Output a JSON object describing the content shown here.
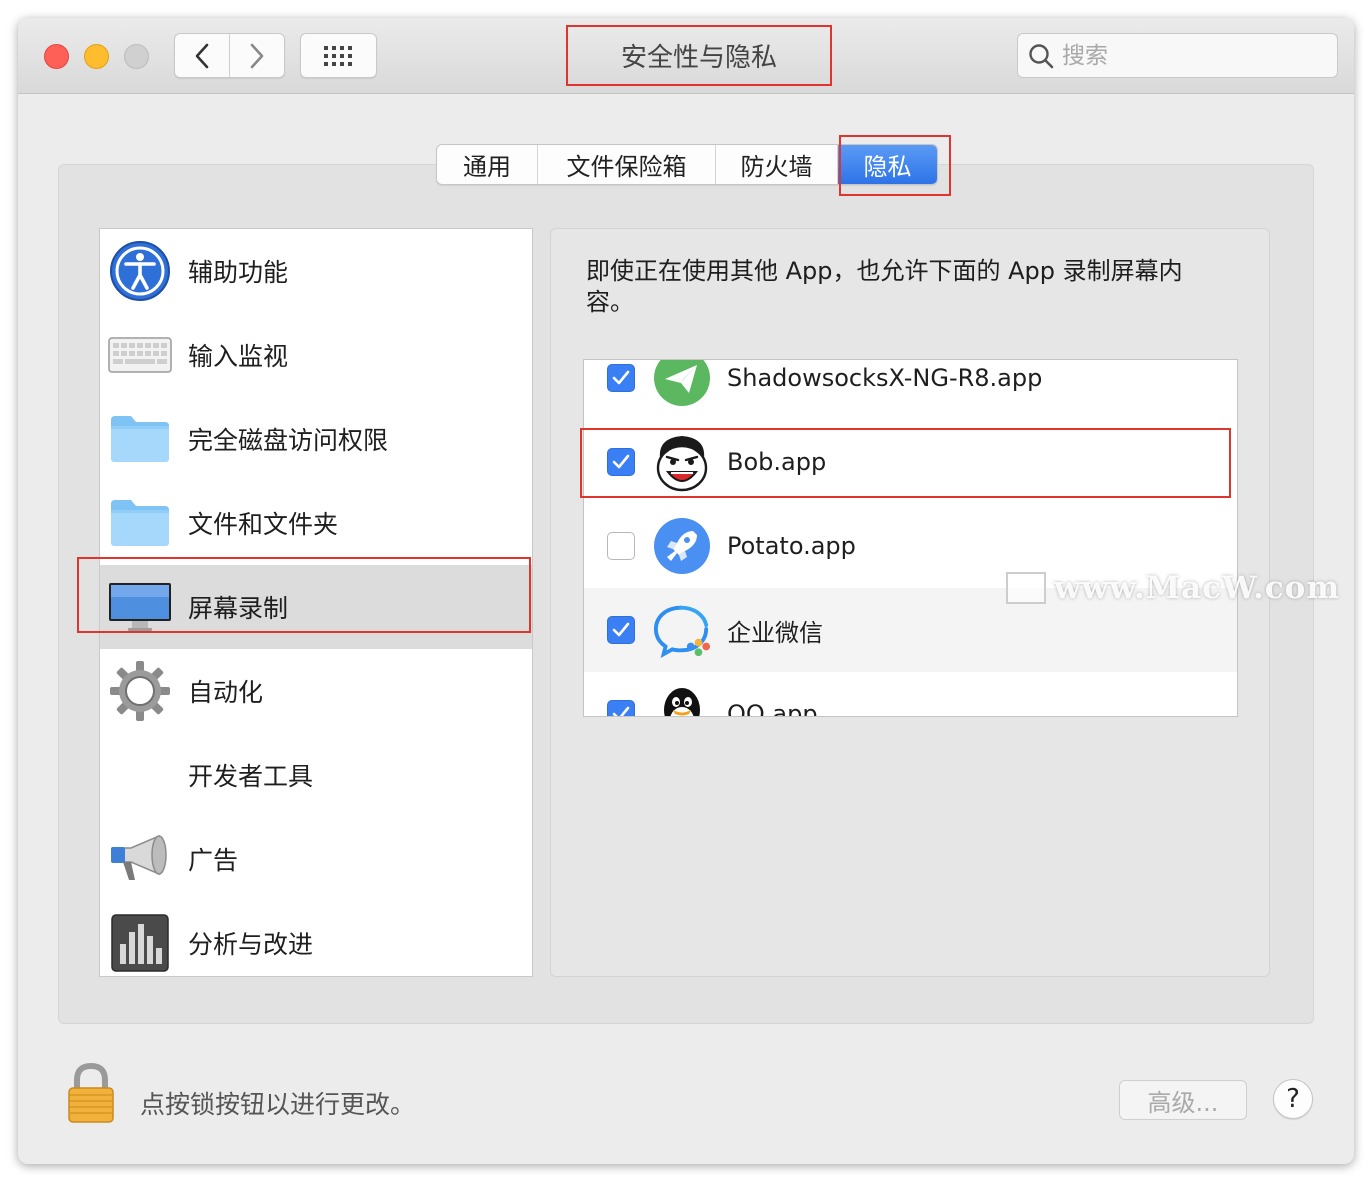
{
  "window": {
    "title": "安全性与隐私",
    "search_placeholder": "搜索"
  },
  "tabs": [
    {
      "label": "通用",
      "active": false
    },
    {
      "label": "文件保险箱",
      "active": false
    },
    {
      "label": "防火墙",
      "active": false
    },
    {
      "label": "隐私",
      "active": true
    }
  ],
  "categories": [
    {
      "label": "辅助功能",
      "icon": "accessibility-icon"
    },
    {
      "label": "输入监视",
      "icon": "keyboard-icon"
    },
    {
      "label": "完全磁盘访问权限",
      "icon": "folder-icon"
    },
    {
      "label": "文件和文件夹",
      "icon": "folder-icon"
    },
    {
      "label": "屏幕录制",
      "icon": "display-icon",
      "selected": true
    },
    {
      "label": "自动化",
      "icon": "gear-icon"
    },
    {
      "label": "开发者工具",
      "icon": ""
    },
    {
      "label": "广告",
      "icon": "megaphone-icon"
    },
    {
      "label": "分析与改进",
      "icon": "bar-chart-icon"
    }
  ],
  "detail": {
    "description": "即使正在使用其他 App，也允许下面的 App 录制屏幕内容。",
    "apps": [
      {
        "label": "ShadowsocksX-NG-R8.app",
        "checked": true,
        "icon": "paper-plane-icon"
      },
      {
        "label": "Bob.app",
        "checked": true,
        "icon": "bob-face-icon"
      },
      {
        "label": "Potato.app",
        "checked": false,
        "icon": "rocket-icon"
      },
      {
        "label": "企业微信",
        "checked": true,
        "icon": "wecom-icon"
      },
      {
        "label": "QQ.app",
        "checked": true,
        "icon": "qq-penguin-icon"
      }
    ]
  },
  "footer": {
    "lock_message": "点按锁按钮以进行更改。",
    "advanced_label": "高级...",
    "help_label": "?"
  },
  "watermark": "www.MacW.com"
}
